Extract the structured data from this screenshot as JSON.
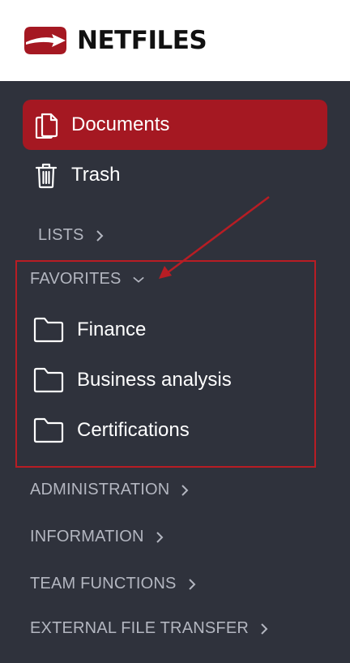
{
  "brand": {
    "name": "NETFILES",
    "logo_color": "#a51822"
  },
  "nav": {
    "documents": {
      "label": "Documents",
      "icon": "documents-icon",
      "active": true
    },
    "trash": {
      "label": "Trash",
      "icon": "trash-icon"
    }
  },
  "sections": {
    "lists": "LISTS",
    "favorites": "FAVORITES",
    "administration": "ADMINISTRATION",
    "information": "INFORMATION",
    "team_functions": "TEAM FUNCTIONS",
    "external_file_transfer": "EXTERNAL FILE TRANSFER"
  },
  "favorites": [
    {
      "label": "Finance",
      "icon": "folder-icon"
    },
    {
      "label": "Business analysis",
      "icon": "folder-icon"
    },
    {
      "label": "Certifications",
      "icon": "folder-icon"
    }
  ],
  "colors": {
    "sidebar_bg": "#2f323c",
    "active_bg": "#a51822",
    "highlight": "#b81d24",
    "section_text": "#b3b6c0"
  }
}
